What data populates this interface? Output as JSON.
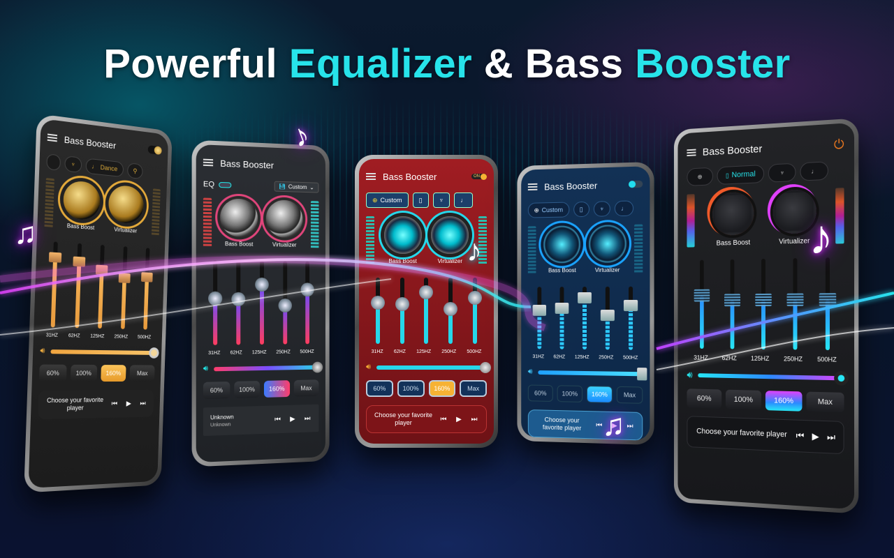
{
  "headline": {
    "part1": "Powerful",
    "part2": "Equalizer",
    "part3": "&",
    "part4": "Bass",
    "part5": "Booster",
    "accent_color": "#27e3ea"
  },
  "phones": [
    {
      "theme": "gold",
      "title": "Bass Booster",
      "header_control": "toggle-icon",
      "presets": [
        {
          "icon": "partial-chip",
          "label": ""
        },
        {
          "icon": "harp-icon",
          "label": ""
        },
        {
          "icon": "guitar-icon",
          "label": "Dance"
        },
        {
          "icon": "microphone-icon",
          "label": ""
        }
      ],
      "knobs": [
        {
          "label": "Bass Boost"
        },
        {
          "label": "Virtualizer"
        }
      ],
      "bands": [
        {
          "label": "31HZ",
          "level": 0.82
        },
        {
          "label": "62HZ",
          "level": 0.78
        },
        {
          "label": "125HZ",
          "level": 0.7
        },
        {
          "label": "250HZ",
          "level": 0.62
        },
        {
          "label": "500HZ",
          "level": 0.64
        }
      ],
      "volume": 1.0,
      "volume_icon": "speaker-icon",
      "amp_buttons": [
        "60%",
        "100%",
        "160%",
        "Max"
      ],
      "amp_selected": "160%",
      "player_text": "Choose your favorite player",
      "controls": [
        "previous-icon",
        "play-icon",
        "next-icon"
      ]
    },
    {
      "theme": "graphite",
      "title": "Bass Booster",
      "eq_label": "EQ",
      "preset_dropdown": "Custom",
      "knobs": [
        {
          "label": "Bass Boost"
        },
        {
          "label": "Virtualizer"
        }
      ],
      "bands": [
        {
          "label": "31HZ",
          "level": 0.55
        },
        {
          "label": "62HZ",
          "level": 0.54
        },
        {
          "label": "125HZ",
          "level": 0.72
        },
        {
          "label": "250HZ",
          "level": 0.47
        },
        {
          "label": "500HZ",
          "level": 0.66
        }
      ],
      "volume": 1.0,
      "volume_icon": "speaker-icon",
      "amp_buttons": [
        "60%",
        "100%",
        "160%",
        "Max"
      ],
      "amp_selected": "160%",
      "player_track": "Unknown",
      "player_artist": "Unknown",
      "controls": [
        "previous-icon",
        "play-icon",
        "next-icon"
      ]
    },
    {
      "theme": "red",
      "title": "Bass Booster",
      "toggle_label": "ON",
      "presets": [
        {
          "icon": "plus-icon",
          "label": "Custom"
        },
        {
          "icon": "speaker-icon",
          "label": ""
        },
        {
          "icon": "harp-icon",
          "label": ""
        },
        {
          "icon": "guitar-icon",
          "label": ""
        }
      ],
      "knobs": [
        {
          "label": "Bass Boost"
        },
        {
          "label": "Virtualizer"
        }
      ],
      "bands": [
        {
          "label": "31HZ",
          "level": 0.62
        },
        {
          "label": "62HZ",
          "level": 0.6
        },
        {
          "label": "125HZ",
          "level": 0.78
        },
        {
          "label": "250HZ",
          "level": 0.53
        },
        {
          "label": "500HZ",
          "level": 0.7
        }
      ],
      "volume": 1.0,
      "volume_icon": "speaker-icon",
      "amp_buttons": [
        "60%",
        "100%",
        "160%",
        "Max"
      ],
      "amp_selected": "160%",
      "player_text": "Choose your favorite player",
      "controls": [
        "previous-icon",
        "play-icon",
        "next-icon"
      ]
    },
    {
      "theme": "blue",
      "title": "Bass Booster",
      "header_control": "toggle-icon",
      "presets": [
        {
          "icon": "plus-icon",
          "label": "Custom"
        },
        {
          "icon": "speaker-icon",
          "label": ""
        },
        {
          "icon": "harp-icon",
          "label": ""
        },
        {
          "icon": "guitar-icon",
          "label": ""
        }
      ],
      "knobs": [
        {
          "label": "Bass Boost"
        },
        {
          "label": "Virtualizer"
        }
      ],
      "bands": [
        {
          "label": "31HZ",
          "level": 0.62
        },
        {
          "label": "62HZ",
          "level": 0.66
        },
        {
          "label": "125HZ",
          "level": 0.82
        },
        {
          "label": "250HZ",
          "level": 0.55
        },
        {
          "label": "500HZ",
          "level": 0.7
        }
      ],
      "volume": 1.0,
      "volume_icon": "speaker-icon",
      "amp_buttons": [
        "60%",
        "100%",
        "160%",
        "Max"
      ],
      "amp_selected": "160%",
      "player_text": "Choose your favorite player",
      "controls": [
        "previous-icon",
        "play-icon",
        "next-icon"
      ]
    },
    {
      "theme": "dark",
      "title": "Bass Booster",
      "header_control": "power-icon",
      "power_color": "#f07a1f",
      "presets": [
        {
          "icon": "plus-icon",
          "label": ""
        },
        {
          "icon": "speaker-icon",
          "label": "Normal"
        },
        {
          "icon": "harp-icon",
          "label": ""
        },
        {
          "icon": "guitar-icon",
          "label": ""
        }
      ],
      "knobs": [
        {
          "label": "Bass Boost"
        },
        {
          "label": "Virtualizer"
        }
      ],
      "bands": [
        {
          "label": "31HZ",
          "level": 0.6
        },
        {
          "label": "62HZ",
          "level": 0.55
        },
        {
          "label": "125HZ",
          "level": 0.55
        },
        {
          "label": "250HZ",
          "level": 0.55
        },
        {
          "label": "500HZ",
          "level": 0.55
        }
      ],
      "volume": 1.0,
      "volume_icon": "speaker-icon",
      "amp_buttons": [
        "60%",
        "100%",
        "160%",
        "Max"
      ],
      "amp_selected": "160%",
      "player_text": "Choose your favorite player",
      "controls": [
        "previous-icon",
        "play-icon",
        "next-icon"
      ]
    }
  ],
  "icons": {
    "music_note": "♪",
    "double_note": "♫"
  }
}
